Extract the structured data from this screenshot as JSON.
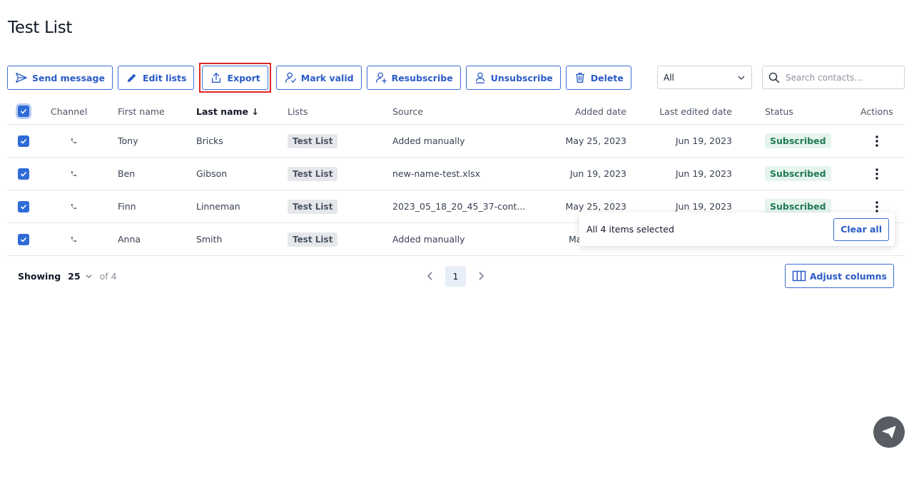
{
  "page": {
    "title": "Test List"
  },
  "toolbar": {
    "send_message": "Send message",
    "edit_lists": "Edit lists",
    "export": "Export",
    "mark_valid": "Mark valid",
    "resubscribe": "Resubscribe",
    "unsubscribe": "Unsubscribe",
    "delete": "Delete"
  },
  "filter": {
    "selected": "All"
  },
  "search": {
    "placeholder": "Search contacts..."
  },
  "table": {
    "columns": {
      "channel": "Channel",
      "first_name": "First name",
      "last_name": "Last name ↓",
      "lists": "Lists",
      "source": "Source",
      "added_date": "Added date",
      "last_edited_date": "Last edited date",
      "status": "Status",
      "actions": "Actions"
    },
    "rows": [
      {
        "first_name": "Tony",
        "last_name": "Bricks",
        "list": "Test List",
        "source": "Added manually",
        "added": "May 25, 2023",
        "edited": "Jun 19, 2023",
        "status": "Subscribed"
      },
      {
        "first_name": "Ben",
        "last_name": "Gibson",
        "list": "Test List",
        "source": "new-name-test.xlsx",
        "added": "Jun 19, 2023",
        "edited": "Jun 19, 2023",
        "status": "Subscribed"
      },
      {
        "first_name": "Finn",
        "last_name": "Linneman",
        "list": "Test List",
        "source": "2023_05_18_20_45_37-cont...",
        "added": "May 25, 2023",
        "edited": "Jun 19, 2023",
        "status": "Subscribed"
      },
      {
        "first_name": "Anna",
        "last_name": "Smith",
        "list": "Test List",
        "source": "Added manually",
        "added": "Ma",
        "edited": "",
        "status": ""
      }
    ]
  },
  "selection_popup": {
    "text": "All 4 items selected",
    "clear_label": "Clear all"
  },
  "footer": {
    "showing_label": "Showing",
    "per_page": "25",
    "of_total": "of 4",
    "current_page": "1",
    "adjust_columns": "Adjust columns"
  },
  "colors": {
    "accent": "#2a5bc7",
    "checkbox": "#2f6bd7",
    "subscribed_bg": "#e6f4ee",
    "subscribed_text": "#1f7a55",
    "highlight": "#e32626"
  }
}
